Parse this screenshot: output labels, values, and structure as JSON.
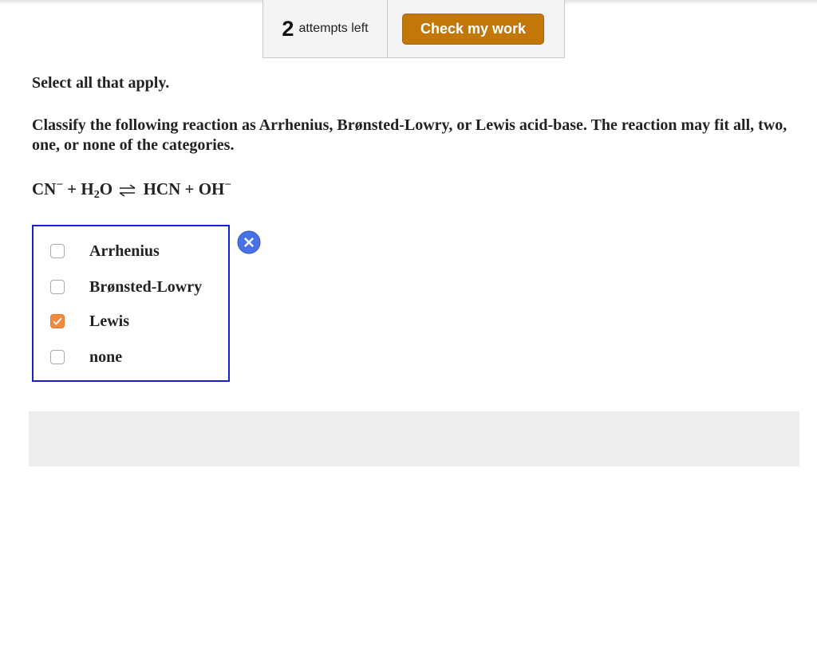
{
  "toolbar": {
    "attempts_count": "2",
    "attempts_label": "attempts left",
    "check_button_label": "Check my work"
  },
  "question": {
    "instruction": "Select all that apply.",
    "prompt": "Classify the following reaction as Arrhenius, Brønsted-Lowry, or Lewis acid-base. The reaction may fit all, two, one, or none of the categories.",
    "equation": {
      "reactant1": "CN",
      "reactant1_charge": "−",
      "plus1": "+",
      "reactant2_symbol_h": "H",
      "reactant2_sub": "2",
      "reactant2_symbol_o": "O",
      "product1": "HCN",
      "plus2": "+",
      "product2": "OH",
      "product2_charge": "−"
    },
    "options": [
      {
        "label": "Arrhenius",
        "checked": false
      },
      {
        "label": "Brønsted-Lowry",
        "checked": false
      },
      {
        "label": "Lewis",
        "checked": true
      },
      {
        "label": "none",
        "checked": false
      }
    ],
    "result_icon": "incorrect-x-icon",
    "colors": {
      "accent_button": "#c27709",
      "checked_box": "#f08a3c",
      "selection_border": "#1320d6",
      "wrong_icon": "#4a72e8"
    }
  }
}
